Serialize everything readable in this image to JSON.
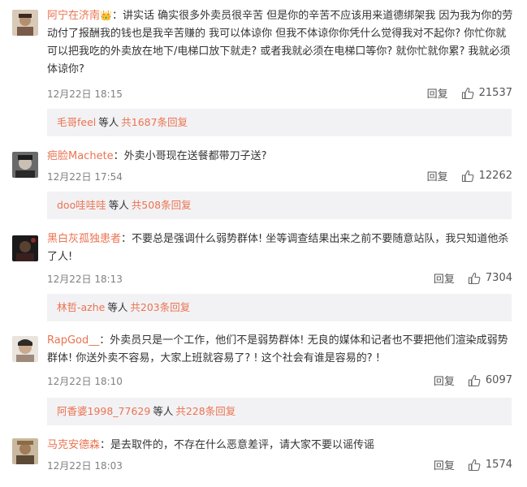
{
  "comments": [
    {
      "username": "阿宁在济南",
      "badge": "👑",
      "text": "：讲实话 确实很多外卖员很辛苦 但是你的辛苦不应该用来道德绑架我 因为我为你的劳动付了报酬我的钱也是我辛苦赚的 我可以体谅你 但我不体谅你你凭什么觉得我对不起你? 你忙你就可以把我吃的外卖放在地下/电梯口放下就走? 或者我就必须在电梯口等你? 就你忙就你累? 我就必须体谅你?",
      "date": "12月22日 18:15",
      "reply_label": "回复",
      "likes": "21537",
      "sub_user": "毛哥feel",
      "sub_text": "等人",
      "sub_count": "共1687条回复"
    },
    {
      "username": "疤脸Machete",
      "text": "：外卖小哥现在送餐都带刀子送?",
      "date": "12月22日 17:54",
      "reply_label": "回复",
      "likes": "12262",
      "sub_user": "doo哇哇哇",
      "sub_text": "等人",
      "sub_count": "共508条回复"
    },
    {
      "username": "黑白灰孤独患者",
      "text": "：不要总是强调什么弱势群体! 坐等调查结果出来之前不要随意站队，我只知道他杀了人!",
      "date": "12月22日 18:13",
      "reply_label": "回复",
      "likes": "7304",
      "sub_user": "林哲-azhe",
      "sub_text": "等人",
      "sub_count": "共203条回复"
    },
    {
      "username": "RapGod__",
      "text": "：外卖员只是一个工作，他们不是弱势群体! 无良的媒体和记者也不要把他们渲染成弱势群体! 你送外卖不容易，大家上班就容易了? ! 这个社会有谁是容易的? !",
      "date": "12月22日 18:10",
      "reply_label": "回复",
      "likes": "6097",
      "sub_user": "阿香婆1998_77629",
      "sub_text": "等人",
      "sub_count": "共228条回复"
    },
    {
      "username": "马克安德森",
      "text": "：是去取件的，不存在什么恶意差评，请大家不要以谣传谣",
      "date": "12月22日 18:03",
      "reply_label": "回复",
      "likes": "1574"
    }
  ],
  "colors": {
    "username": "#eb7350",
    "subbox_bg": "#f2f2f5",
    "meta": "#808080"
  },
  "icons": {
    "like": "thumbs-up-icon",
    "badge": "crown-badge-icon"
  }
}
